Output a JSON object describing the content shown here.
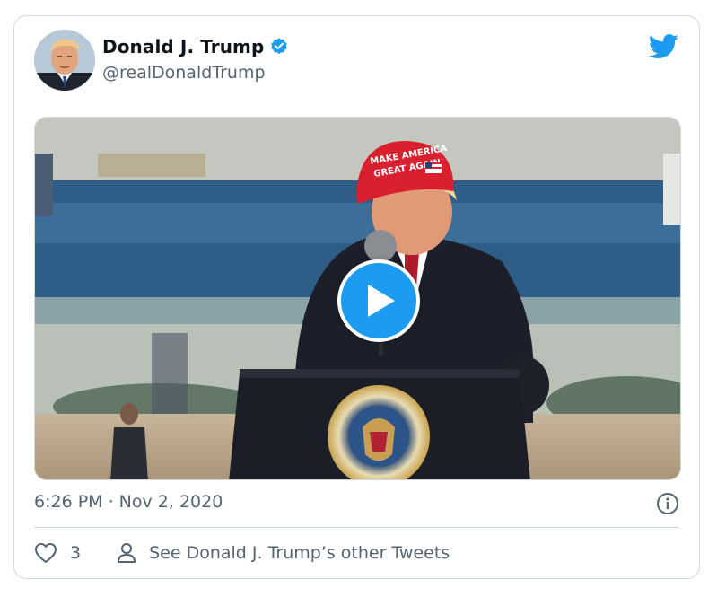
{
  "tweet": {
    "author_name": "Donald J. Trump",
    "author_handle": "@realDonaldTrump",
    "timestamp": "6:26 PM · Nov 2, 2020",
    "like_count": "3",
    "see_more_label": "See Donald J. Trump’s other Tweets"
  },
  "media": {
    "cap_text_line1": "MAKE AMERICA",
    "cap_text_line2": "GREAT AGAIN",
    "seal_text": "SEAL OF THE PRESIDENT OF THE UNITED STATES"
  },
  "icons": {
    "verified": "verified-badge-icon",
    "brand": "twitter-bird-icon",
    "play": "play-icon",
    "info": "info-icon",
    "like": "heart-icon",
    "profile": "person-icon"
  },
  "colors": {
    "accent": "#1d9bf0",
    "text_primary": "#0f1419",
    "text_secondary": "#536471",
    "border": "#cfd9de"
  }
}
